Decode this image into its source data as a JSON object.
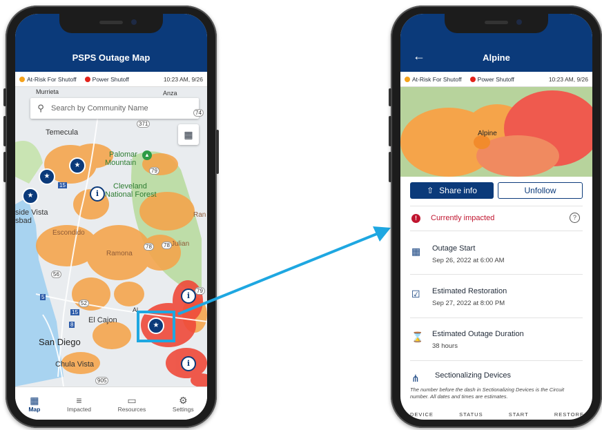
{
  "left_phone": {
    "title": "PSPS Outage Map",
    "legend": {
      "at_risk": "At-Risk For Shutoff",
      "shutoff": "Power Shutoff",
      "timestamp": "10:23 AM, 9/26"
    },
    "search_placeholder": "Search by Community Name",
    "map_labels": {
      "murrieta": "Murrieta",
      "anza": "Anza",
      "temecula": "Temecula",
      "palomar": "Palomar",
      "mountain": "Mountain",
      "cleveland": "Cleveland",
      "national_forest": "National Forest",
      "vista": "side Vista",
      "carlsbad": "sbad",
      "escondido": "Escondido",
      "ramona": "Ramona",
      "julian": "Julian",
      "el_cajon": "El Cajon",
      "san_diego": "San Diego",
      "chula_vista": "Chula Vista",
      "ran": "Ran",
      "r371": "371",
      "r79a": "79",
      "r79b": "79",
      "r78": "78",
      "r78b": "78",
      "r15": "15",
      "r15b": "15",
      "r8": "8",
      "r5": "5",
      "r56": "56",
      "r52": "52",
      "r905": "905",
      "r74": "74",
      "alpine_short": "Al"
    },
    "tabs": [
      {
        "label": "Map",
        "icon": "map-icon"
      },
      {
        "label": "Impacted",
        "icon": "list-icon"
      },
      {
        "label": "Resources",
        "icon": "folder-icon"
      },
      {
        "label": "Settings",
        "icon": "gear-icon"
      }
    ]
  },
  "right_phone": {
    "title": "Alpine",
    "legend": {
      "at_risk": "At-Risk For Shutoff",
      "shutoff": "Power Shutoff",
      "timestamp": "10:23 AM, 9/26"
    },
    "map_label": "Alpine",
    "share_label": "Share info",
    "unfollow_label": "Unfollow",
    "status": "Currently impacted",
    "rows": [
      {
        "title": "Outage Start",
        "value": "Sep 26, 2022 at 6:00 AM",
        "icon": "calendar-x-icon"
      },
      {
        "title": "Estimated Restoration",
        "value": "Sep 27, 2022 at 8:00 PM",
        "icon": "calendar-check-icon"
      },
      {
        "title": "Estimated Outage Duration",
        "value": "38 hours",
        "icon": "hourglass-icon"
      }
    ],
    "devices_title": "Sectionalizing Devices",
    "note": "The number before the dash in Sectionalizing Devices is the Circuit number. All dates and times are estimates.",
    "columns": [
      "DEVICE",
      "STATUS",
      "START",
      "RESTORE"
    ]
  },
  "colors": {
    "brand": "#0b3a7a",
    "at_risk": "#f5a21b",
    "shutoff": "#e3231b",
    "highlight": "#1ea7e1"
  }
}
